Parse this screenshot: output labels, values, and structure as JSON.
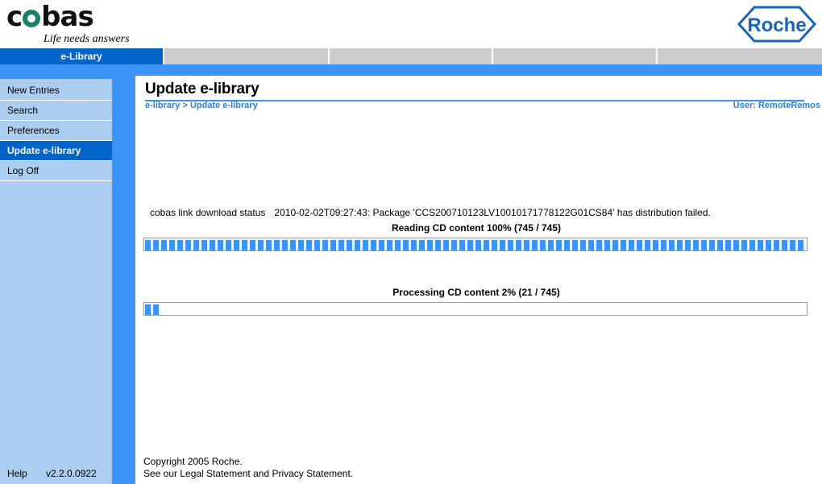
{
  "brand": {
    "product_name": "cobas",
    "tagline": "Life needs answers",
    "corporate_logo_text": "Roche"
  },
  "tabs": [
    {
      "label": "e-Library",
      "active": true
    },
    {
      "label": "",
      "active": false
    },
    {
      "label": "",
      "active": false
    },
    {
      "label": "",
      "active": false
    },
    {
      "label": "",
      "active": false
    }
  ],
  "sidebar": {
    "items": [
      {
        "label": "New Entries",
        "active": false
      },
      {
        "label": "Search",
        "active": false
      },
      {
        "label": "Preferences",
        "active": false
      },
      {
        "label": "Update e-library",
        "active": true
      },
      {
        "label": "Log Off",
        "active": false
      }
    ],
    "help_label": "Help",
    "version": "v2.2.0.0922"
  },
  "main": {
    "title": "Update e-library",
    "breadcrumb": "e-library > Update e-library",
    "user_label": "User: RemoteRemos",
    "status": {
      "source": "cobas link download status",
      "message": "2010-02-02T09:27:43: Package 'CCS200710123LV10010171778122G01CS84' has distribution failed."
    },
    "progress": [
      {
        "label": "Reading CD content 100% (745 / 745)",
        "percent": 100,
        "current": 745,
        "total": 745,
        "chunks": 82
      },
      {
        "label": "Processing CD content 2% (21 / 745)",
        "percent": 2,
        "current": 21,
        "total": 745,
        "chunks": 2
      }
    ]
  },
  "footer": {
    "copyright": "Copyright 2005 Roche.",
    "legal": "See our Legal Statement and Privacy Statement."
  },
  "colors": {
    "accent_blue": "#3b93f7",
    "tab_active_blue": "#0064c8",
    "sidebar_blue": "#aacdf0",
    "tab_inactive_gray": "#cccccc",
    "link_blue": "#2a7fe0",
    "cobas_mark_teal": "#1b7f6a",
    "roche_blue": "#1a63b5"
  }
}
